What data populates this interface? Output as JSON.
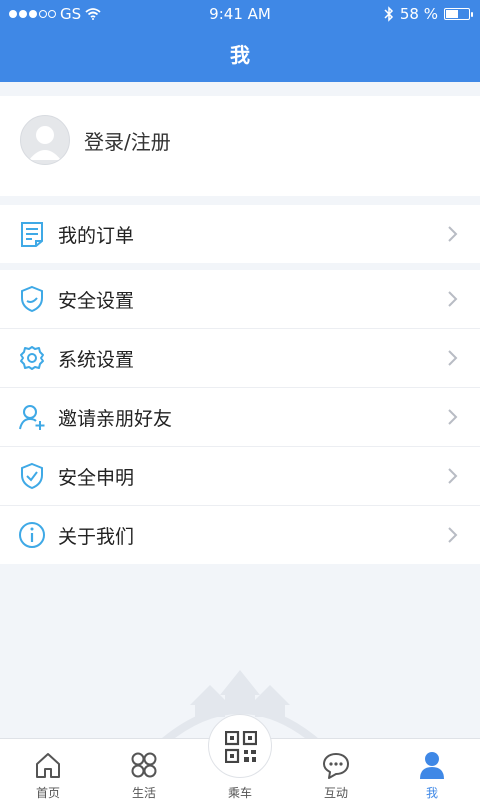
{
  "status_bar": {
    "carrier": "GS",
    "time": "9:41 AM",
    "battery_text": "58 %",
    "battery_level": 0.58
  },
  "nav": {
    "title": "我"
  },
  "profile": {
    "login_label": "登录/注册"
  },
  "orders": {
    "label": "我的订单"
  },
  "menu": [
    {
      "label": "安全设置",
      "icon": "shield-icon"
    },
    {
      "label": "系统设置",
      "icon": "gear-icon"
    },
    {
      "label": "邀请亲朋好友",
      "icon": "add-user-icon"
    },
    {
      "label": "安全申明",
      "icon": "shield-check-icon"
    },
    {
      "label": "关于我们",
      "icon": "info-icon"
    }
  ],
  "tabbar": {
    "tabs": [
      {
        "label": "首页",
        "icon": "home-icon"
      },
      {
        "label": "生活",
        "icon": "life-icon"
      },
      {
        "label": "乘车",
        "icon": "qr-code-icon"
      },
      {
        "label": "互动",
        "icon": "chat-icon"
      },
      {
        "label": "我",
        "icon": "person-icon"
      }
    ],
    "active_index": 4
  },
  "colors": {
    "primary": "#3f88e6",
    "background": "#f2f5f9",
    "icon_blue": "#3fa9e6"
  }
}
